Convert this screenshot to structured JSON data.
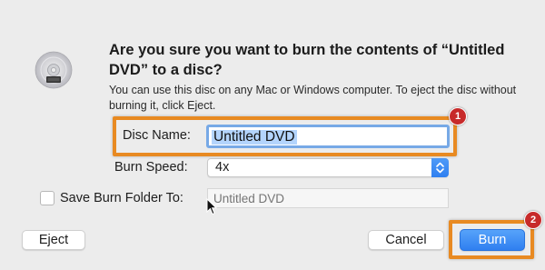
{
  "dialog": {
    "title": "Are you sure you want to burn the contents of “Untitled DVD” to a disc?",
    "message": "You can use this disc on any Mac or Windows computer. To eject the disc without burning it, click Eject.",
    "icon": "dvd-disc-icon"
  },
  "form": {
    "disc_name_label": "Disc Name:",
    "disc_name_value": "Untitled DVD",
    "burn_speed_label": "Burn Speed:",
    "burn_speed_value": "4x",
    "save_folder_label": "Save Burn Folder To:",
    "save_folder_checked": false,
    "save_folder_placeholder": "Untitled DVD"
  },
  "buttons": {
    "eject": "Eject",
    "cancel": "Cancel",
    "burn": "Burn"
  },
  "annotations": {
    "badge_1": "1",
    "badge_2": "2",
    "highlight_color": "#e88a22",
    "badge_color": "#c72a2a"
  },
  "colors": {
    "accent": "#2f7ff0",
    "selection": "#b3d4fc",
    "background": "#ececec"
  }
}
